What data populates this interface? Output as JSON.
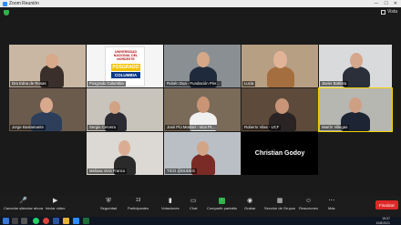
{
  "window": {
    "title": "Zoom Reunión",
    "minimize": "—",
    "maximize": "☐",
    "close": "✕"
  },
  "view_button": {
    "label": "Vista"
  },
  "participants": [
    {
      "name": "Dra Edna de Rosas"
    },
    {
      "name": "Posgrado Columbia"
    },
    {
      "name": "Rubén Dua - Fundación Pier..."
    },
    {
      "name": "Lucia"
    },
    {
      "name": "Javier Battista"
    },
    {
      "name": "Jorge Bustamante"
    },
    {
      "name": "Sergio Cervera"
    },
    {
      "name": "José Pío Montiel - Vice Pt..."
    },
    {
      "name": "Roberto Vilas - UCF"
    },
    {
      "name": "Martín Villegas"
    },
    {
      "name": "Melissa Vera Franco"
    },
    {
      "name": "TICO @DUDES"
    },
    {
      "name": "Christian Godoy"
    }
  ],
  "logo_card": {
    "university": "UNIVERSIDAD NACIONAL DEL NORDESTE",
    "posgrado": "POSGRADO",
    "columbia": "COLUMBIA"
  },
  "toolbar": {
    "mute": "Cancelar silenciar ahora",
    "video": "Iniciar video",
    "security": "Seguridad",
    "participants": "Participantes",
    "participants_count": "13",
    "polls": "Votaciones",
    "chat": "Chat",
    "share": "Compartir pantalla",
    "record": "Grabar",
    "breakout": "Sección de Grupos",
    "reactions": "Reacciones",
    "more": "Más",
    "finish": "Finalizar"
  },
  "taskbar": {
    "time": "15:07",
    "date": "10/8/2021"
  },
  "colors": {
    "finish": "#e02828",
    "active_border": "#f3d300",
    "share_icon": "#2fb34a"
  }
}
